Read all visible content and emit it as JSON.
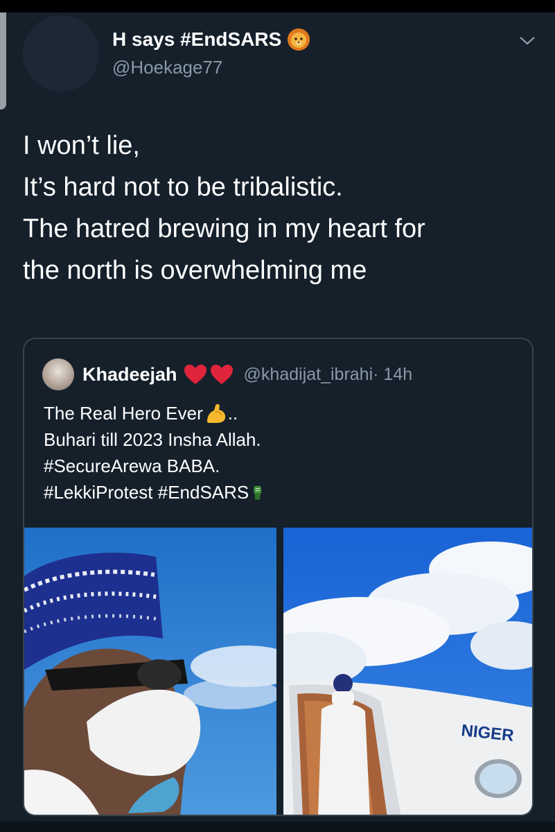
{
  "tweet": {
    "display_name": "H says #EndSARS",
    "handle": "@Hoekage77",
    "lines": [
      "I won’t lie,",
      "It’s hard not to be tribalistic.",
      "The hatred brewing in my heart for",
      "the north is overwhelming me"
    ]
  },
  "quoted_tweet": {
    "name": "Khadeejah",
    "handle": "@khadijat_ibrahi",
    "time": "· 14h",
    "lines": [
      "The Real Hero Ever",
      "..",
      "Buhari till 2023 Insha Allah.",
      "#SecureArewa BABA.",
      "#LekkiProtest #EndSARS"
    ],
    "photo_text": "NIGER"
  },
  "icons": {
    "name_emoji": "lion-face-icon",
    "hearts": [
      "red-heart-icon",
      "red-heart-icon"
    ],
    "flexed_biceps": "flexed-biceps-icon",
    "raised_fist": "raised-fist-icon",
    "menu": "chevron-down-icon"
  },
  "colors": {
    "background": "#15202b",
    "secondary_text": "#8899a6",
    "border": "#38444d"
  }
}
